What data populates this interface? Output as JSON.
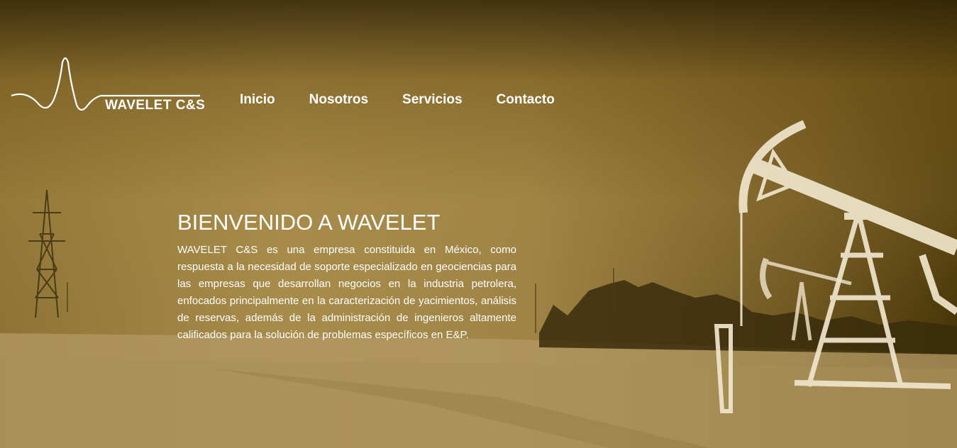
{
  "brand": {
    "name": "WAVELET C&S"
  },
  "nav": {
    "items": [
      {
        "label": "Inicio"
      },
      {
        "label": "Nosotros"
      },
      {
        "label": "Servicios"
      },
      {
        "label": "Contacto"
      }
    ]
  },
  "hero": {
    "title": "BIENVENIDO A WAVELET",
    "description": "WAVELET C&S es una empresa constituida en México, como respuesta a la necesidad de soporte especializado en geociencias para las empresas que desarrollan negocios en la industria petrolera, enfocados principalmente en la caracterización de yacimientos, análisis de reservas, además de la administración de ingenieros altamente calificados para la solución de problemas específicos en E&P."
  },
  "colors": {
    "text": "#ffffff",
    "tint_dark": "#4a3708",
    "tint_light": "#b49a5e"
  },
  "icons": [
    "wavelet-logo-icon",
    "oil-pump-jack-image",
    "power-tower-image"
  ]
}
